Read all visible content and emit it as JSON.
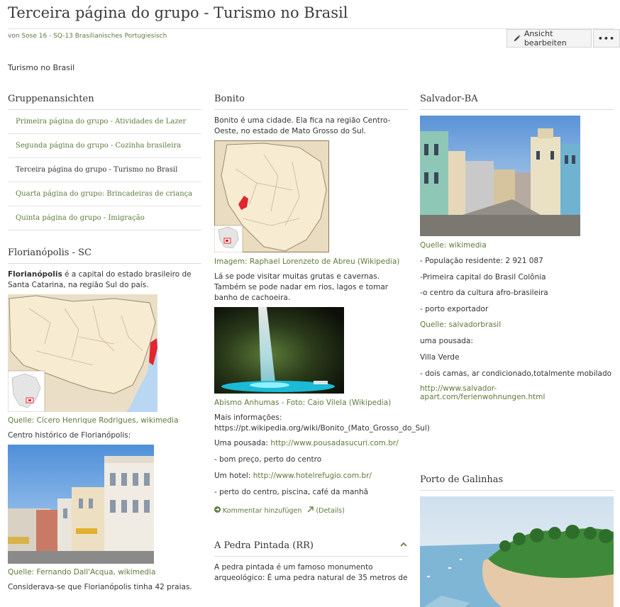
{
  "page": {
    "title": "Terceira página do grupo - Turismo no Brasil",
    "byline_prefix": "von",
    "byline_author": "Sose 16 - SQ-13 Brasilianisches Portugiesisch",
    "intro": "Turismo no Brasil"
  },
  "toolbar": {
    "edit_label": "Ansicht bearbeiten",
    "more_label": "•••"
  },
  "groups": {
    "title": "Gruppenansichten",
    "items": [
      {
        "label": "Primeira página do grupo - Atividades de Lazer"
      },
      {
        "label": "Segunda página do grupo - Cozinha brasileira"
      },
      {
        "label": "Terceira página do grupo - Turismo no Brasil"
      },
      {
        "label": "Quarta página do grupo: Brincadeiras de criança"
      },
      {
        "label": "Quinta página do grupo - Imigração"
      }
    ]
  },
  "floripa": {
    "title": "Florianópolis - SC",
    "text_bold": "Florianópolis",
    "text_rest": " é a capital do estado brasileiro de Santa Catarina, na região Sul do país.",
    "caption1": "Quelle: Cícero Henrique Rodrigues, wikimedia",
    "subtitle": "Centro histórico de Florianópolis:",
    "caption2": "Quelle: Fernando Dall'Acqua, wikimedia",
    "text2": "Considerava-se que Florianópolis tinha 42 praias."
  },
  "bonito": {
    "title": "Bonito",
    "text1": "Bonito é uma cidade. Ela fica na região Centro-Oeste, no estado de Mato Grosso do Sul.",
    "caption1": "Imagem: Raphael Lorenzeto de Abreu (Wikipedia)",
    "text2": "Lá se pode visitar muitas grutas e cavernas. Também se pode nadar em rios, lagos e tomar banho de cachoeira.",
    "caption2": "Abismo Anhumas - Foto: Caio Vilela (Wikipedia)",
    "more_info_label": " Mais informações:",
    "more_info_link": "https://pt.wikipedia.org/wiki/Bonito_(Mato_Grosso_do_Sul)",
    "pousada_label": "Uma pousada: ",
    "pousada_link": "http://www.pousadasucuri.com.br/",
    "pousada_desc": "- bom preço, perto do centro",
    "hotel_label": "Um hotel: ",
    "hotel_link": "http://www.hotelrefugio.com.br/",
    "hotel_desc": "- perto do centro, piscina, café da manhã",
    "comment_label": "Kommentar hinzufügen",
    "details_label": "(Details)"
  },
  "pedra": {
    "title": "A Pedra Pintada (RR)",
    "text": "A pedra pintada é um famoso monumento arqueológico: É uma pedra natural de 35 metros de"
  },
  "salvador": {
    "title": "Salvador-BA",
    "caption1": "Quelle: wikimedia",
    "lines": [
      "- População residente: 2 921 087",
      "-Primeira capital do Brasil Colônia",
      "-o centro da cultura afro-brasileira",
      "- porto exportador"
    ],
    "caption2": "Quelle: salvadorbrasil",
    "lines2": [
      "uma pousada:",
      "Villa Verde",
      "- dois camas, ar condicionado,totalmente mobilado"
    ],
    "link": "http://www.salvador-apart.com/ferienwohnungen.html"
  },
  "galinhas": {
    "title": "Porto de Galinhas"
  },
  "colors": {
    "link": "#5b7a3a",
    "map_state": "#f7ecd2",
    "map_highlight": "#e2262e",
    "water": "#b9d6f2"
  }
}
